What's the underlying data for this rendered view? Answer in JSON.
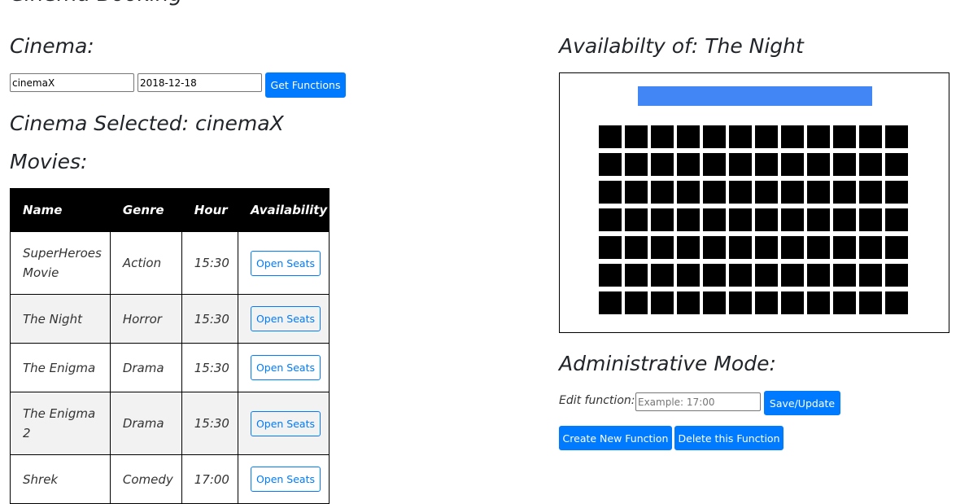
{
  "page": {
    "cut_heading": "Cinema Book­ing",
    "cinema_heading": "Cinema:",
    "selected_prefix": "Cinema Selected: ",
    "selected_value": "cinemaX",
    "movies_heading": "Movies:"
  },
  "search": {
    "cinema_value": "cinemaX",
    "date_value": "2018-12-18",
    "get_functions_label": "Get Functions"
  },
  "movies": {
    "headers": [
      "Name",
      "Genre",
      "Hour",
      "Availability"
    ],
    "rows": [
      {
        "name": "SuperHeroes Movie",
        "genre": "Action",
        "hour": "15:30",
        "action": "Open Seats"
      },
      {
        "name": "The Night",
        "genre": "Horror",
        "hour": "15:30",
        "action": "Open Seats"
      },
      {
        "name": "The Enigma",
        "genre": "Drama",
        "hour": "15:30",
        "action": "Open Seats"
      },
      {
        "name": "The Enigma 2",
        "genre": "Drama",
        "hour": "15:30",
        "action": "Open Seats"
      },
      {
        "name": "Shrek",
        "genre": "Comedy",
        "hour": "17:00",
        "action": "Open Seats"
      }
    ]
  },
  "availability": {
    "heading": "Availabilty of: The Night",
    "rows": 7,
    "cols": 12,
    "screen_color": "#4285f4",
    "seat_color": "#000000"
  },
  "admin": {
    "heading": "Administrative Mode:",
    "edit_label": "Edit function:",
    "edit_placeholder": "Example: 17:00",
    "save_label": "Save/Update",
    "create_label": "Create New Function",
    "delete_label": "Delete this Function"
  },
  "colors": {
    "primary": "#007bff",
    "header_bg": "#000000",
    "stripe": "#f2f2f2"
  }
}
